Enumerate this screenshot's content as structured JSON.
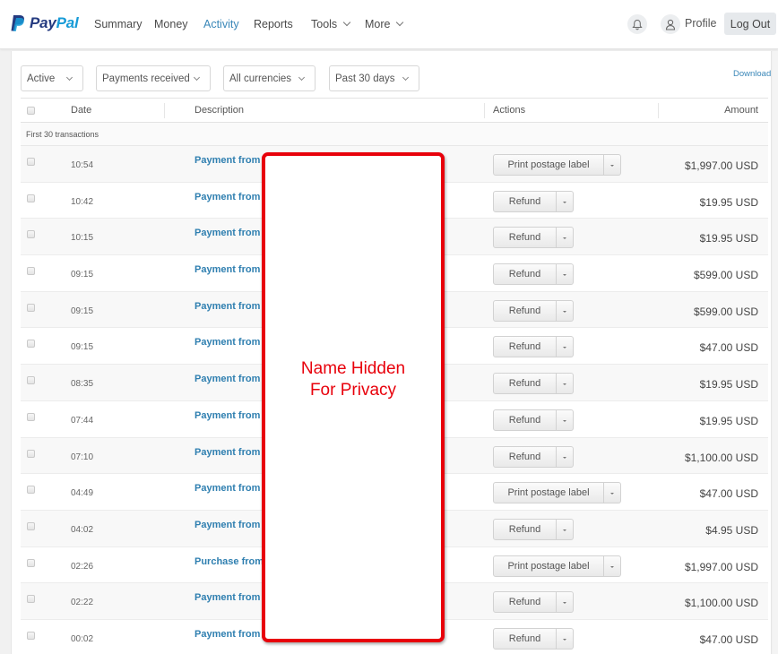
{
  "brand": {
    "name_part1": "Pay",
    "name_part2": "Pal",
    "color_dark": "#253b80",
    "color_light": "#179bd7"
  },
  "nav": {
    "items": [
      {
        "label": "Summary",
        "active": false,
        "has_dropdown": false
      },
      {
        "label": "Money",
        "active": false,
        "has_dropdown": false
      },
      {
        "label": "Activity",
        "active": true,
        "has_dropdown": false
      },
      {
        "label": "Reports",
        "active": false,
        "has_dropdown": false
      },
      {
        "label": "Tools",
        "active": false,
        "has_dropdown": true
      },
      {
        "label": "More",
        "active": false,
        "has_dropdown": true
      }
    ],
    "notifications_icon": "bell-icon",
    "profile_icon": "user-icon",
    "profile_label": "Profile",
    "logout_label": "Log Out"
  },
  "filters": {
    "status": "Active",
    "type": "Payments received",
    "currency": "All currencies",
    "period": "Past 30 days",
    "download_label": "Download"
  },
  "table": {
    "headers": {
      "date": "Date",
      "description": "Description",
      "actions": "Actions",
      "amount": "Amount"
    },
    "group_label": "First 30 transactions",
    "rows": [
      {
        "time": "10:54",
        "description": "Payment from",
        "action": "Print postage label",
        "amount": "$1,997.00 USD"
      },
      {
        "time": "10:42",
        "description": "Payment from",
        "action": "Refund",
        "amount": "$19.95 USD"
      },
      {
        "time": "10:15",
        "description": "Payment from",
        "action": "Refund",
        "amount": "$19.95 USD"
      },
      {
        "time": "09:15",
        "description": "Payment from",
        "action": "Refund",
        "amount": "$599.00 USD"
      },
      {
        "time": "09:15",
        "description": "Payment from",
        "action": "Refund",
        "amount": "$599.00 USD"
      },
      {
        "time": "09:15",
        "description": "Payment from",
        "action": "Refund",
        "amount": "$47.00 USD"
      },
      {
        "time": "08:35",
        "description": "Payment from",
        "action": "Refund",
        "amount": "$19.95 USD"
      },
      {
        "time": "07:44",
        "description": "Payment from",
        "action": "Refund",
        "amount": "$19.95 USD"
      },
      {
        "time": "07:10",
        "description": "Payment from",
        "action": "Refund",
        "amount": "$1,100.00 USD"
      },
      {
        "time": "04:49",
        "description": "Payment from",
        "action": "Print postage label",
        "amount": "$47.00 USD"
      },
      {
        "time": "04:02",
        "description": "Payment from",
        "action": "Refund",
        "amount": "$4.95 USD"
      },
      {
        "time": "02:26",
        "description": "Purchase from",
        "action": "Print postage label",
        "amount": "$1,997.00 USD"
      },
      {
        "time": "02:22",
        "description": "Payment from",
        "action": "Refund",
        "amount": "$1,100.00 USD"
      },
      {
        "time": "00:02",
        "description": "Payment from",
        "action": "Refund",
        "amount": "$47.00 USD"
      }
    ]
  },
  "privacy_overlay": {
    "line1": "Name Hidden",
    "line2": "For Privacy",
    "color": "#e8000b"
  }
}
